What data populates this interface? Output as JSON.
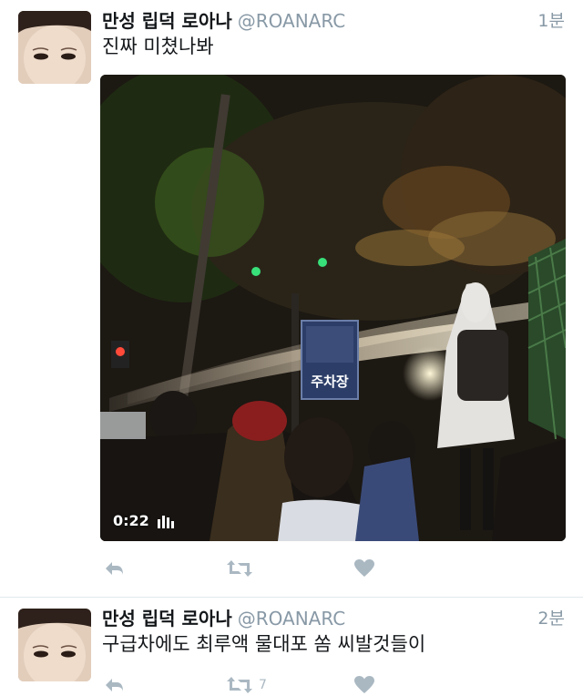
{
  "tweets": [
    {
      "name": "만성 립덕 로아나",
      "handle": "@ROANARC",
      "time": "1분",
      "text": "진짜 미쳤나봐",
      "video": {
        "duration": "0:22",
        "sign_text": "주차장"
      },
      "actions": {
        "reply": "reply-icon",
        "retweet": "retweet-icon",
        "like": "heart-icon"
      }
    },
    {
      "name": "만성 립덕 로아나",
      "handle": "@ROANARC",
      "time": "2분",
      "text": "구급차에도 최루액 물대포 쏨 씨발것들이",
      "actions": {
        "reply": "reply-icon",
        "retweet": "retweet-icon",
        "retweet_count": "7",
        "like": "heart-icon"
      }
    }
  ],
  "colors": {
    "text": "#14171a",
    "secondary": "#8899a6",
    "action": "#aab8c2",
    "divider": "#e1e8ed"
  }
}
